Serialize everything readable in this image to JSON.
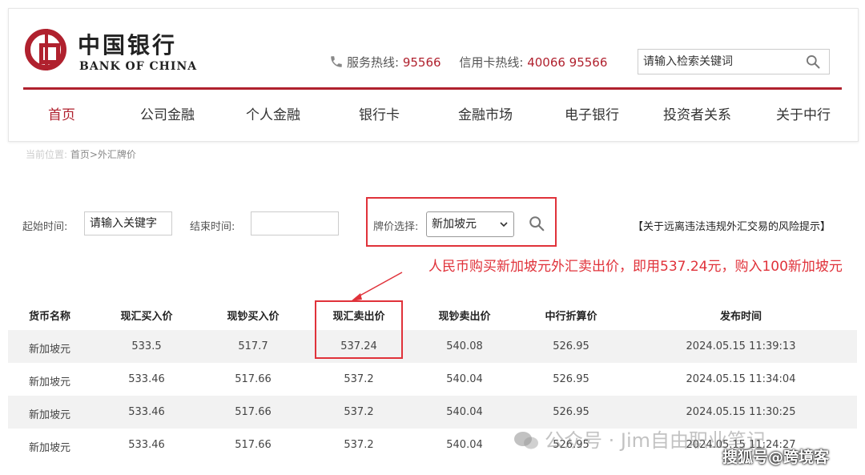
{
  "brand": {
    "name_cn": "中国银行",
    "name_en": "BANK OF CHINA",
    "color": "#b0212e"
  },
  "header": {
    "service_label": "服务热线:",
    "service_number": "95566",
    "card_label": "信用卡热线:",
    "card_number": "40066 95566",
    "search_placeholder": "请输入检索关键词"
  },
  "nav": [
    "首页",
    "公司金融",
    "个人金融",
    "银行卡",
    "金融市场",
    "电子银行",
    "投资者关系",
    "关于中行"
  ],
  "breadcrumb": {
    "prefix": "当前位置:",
    "path": "首页>外汇牌价"
  },
  "filters": {
    "start_label": "起始时间:",
    "start_value": "请输入关键字",
    "end_label": "结束时间:",
    "end_value": "",
    "currency_label": "牌价选择:",
    "currency_selected": "新加坡元",
    "risk_link": "【关于远离违法违规外汇交易的风险提示】"
  },
  "annotation": {
    "text": "人民币购买新加坡元外汇卖出价，即用537.24元，购入100新加坡元",
    "color": "#e0323a"
  },
  "table": {
    "headers": [
      "货币名称",
      "现汇买入价",
      "现钞买入价",
      "现汇卖出价",
      "现钞卖出价",
      "中行折算价",
      "发布时间"
    ],
    "rows": [
      [
        "新加坡元",
        "533.5",
        "517.7",
        "537.24",
        "540.08",
        "526.95",
        "2024.05.15 11:39:13"
      ],
      [
        "新加坡元",
        "533.46",
        "517.66",
        "537.2",
        "540.04",
        "526.95",
        "2024.05.15 11:34:04"
      ],
      [
        "新加坡元",
        "533.46",
        "517.66",
        "537.2",
        "540.04",
        "526.95",
        "2024.05.15 11:30:25"
      ],
      [
        "新加坡元",
        "533.46",
        "517.66",
        "537.2",
        "540.04",
        "526.95",
        "2024.05.15 11:24:27"
      ]
    ]
  },
  "watermark": {
    "text": "公众号 · Jim自由职业笔记",
    "corner_text": "搜狐号@跨境客"
  }
}
